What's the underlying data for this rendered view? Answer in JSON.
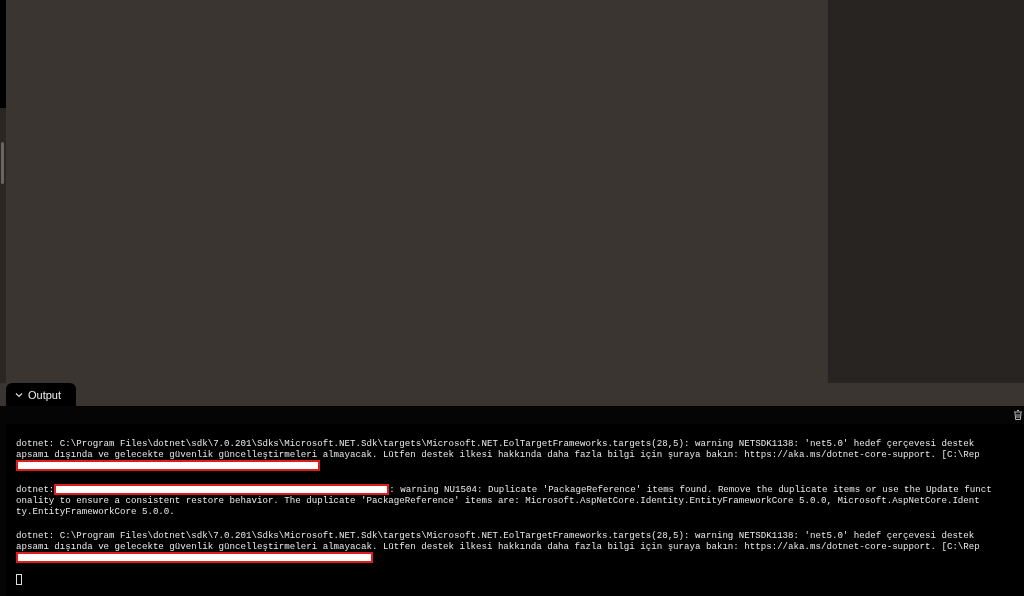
{
  "output_panel": {
    "tab": {
      "label": "Output",
      "expanded": true
    },
    "blocks": [
      {
        "lines": [
          [
            {
              "kind": "text",
              "text": "dotnet: C:\\Program Files\\dotnet\\sdk\\7.0.201\\Sdks\\Microsoft.NET.Sdk\\targets\\Microsoft.NET.EolTargetFrameworks.targets(28,5): warning NETSDK1138: 'net5.0' hedef çerçevesi destek"
            }
          ],
          [
            {
              "kind": "text",
              "text": "apsamı dışında ve gelecekte güvenlik güncelleştirmeleri almayacak. Lütfen destek ilkesi hakkında daha fazla bilgi için şuraya bakın: https://aka.ms/dotnet-core-support. [C:\\Rep"
            }
          ],
          [
            {
              "kind": "redaction"
            }
          ]
        ]
      },
      {
        "lines": [
          [
            {
              "kind": "text",
              "text": "dotnet:"
            },
            {
              "kind": "redaction"
            },
            {
              "kind": "text",
              "text": ": warning NU1504: Duplicate 'PackageReference' items found. Remove the duplicate items or use the Update funct"
            }
          ],
          [
            {
              "kind": "text",
              "text": "onality to ensure a consistent restore behavior. The duplicate 'PackageReference' items are: Microsoft.AspNetCore.Identity.EntityFrameworkCore 5.0.0, Microsoft.AspNetCore.Ident"
            }
          ],
          [
            {
              "kind": "text",
              "text": "ty.EntityFrameworkCore 5.0.0."
            }
          ]
        ]
      },
      {
        "lines": [
          [
            {
              "kind": "text",
              "text": "dotnet: C:\\Program Files\\dotnet\\sdk\\7.0.201\\Sdks\\Microsoft.NET.Sdk\\targets\\Microsoft.NET.EolTargetFrameworks.targets(28,5): warning NETSDK1138: 'net5.0' hedef çerçevesi destek"
            }
          ],
          [
            {
              "kind": "text",
              "text": "apsamı dışında ve gelecekte güvenlik güncelleştirmeleri almayacak. Lütfen destek ilkesi hakkında daha fazla bilgi için şuraya bakın: https://aka.ms/dotnet-core-support. [C:\\Rep"
            }
          ],
          [
            {
              "kind": "redaction"
            }
          ]
        ]
      }
    ]
  }
}
